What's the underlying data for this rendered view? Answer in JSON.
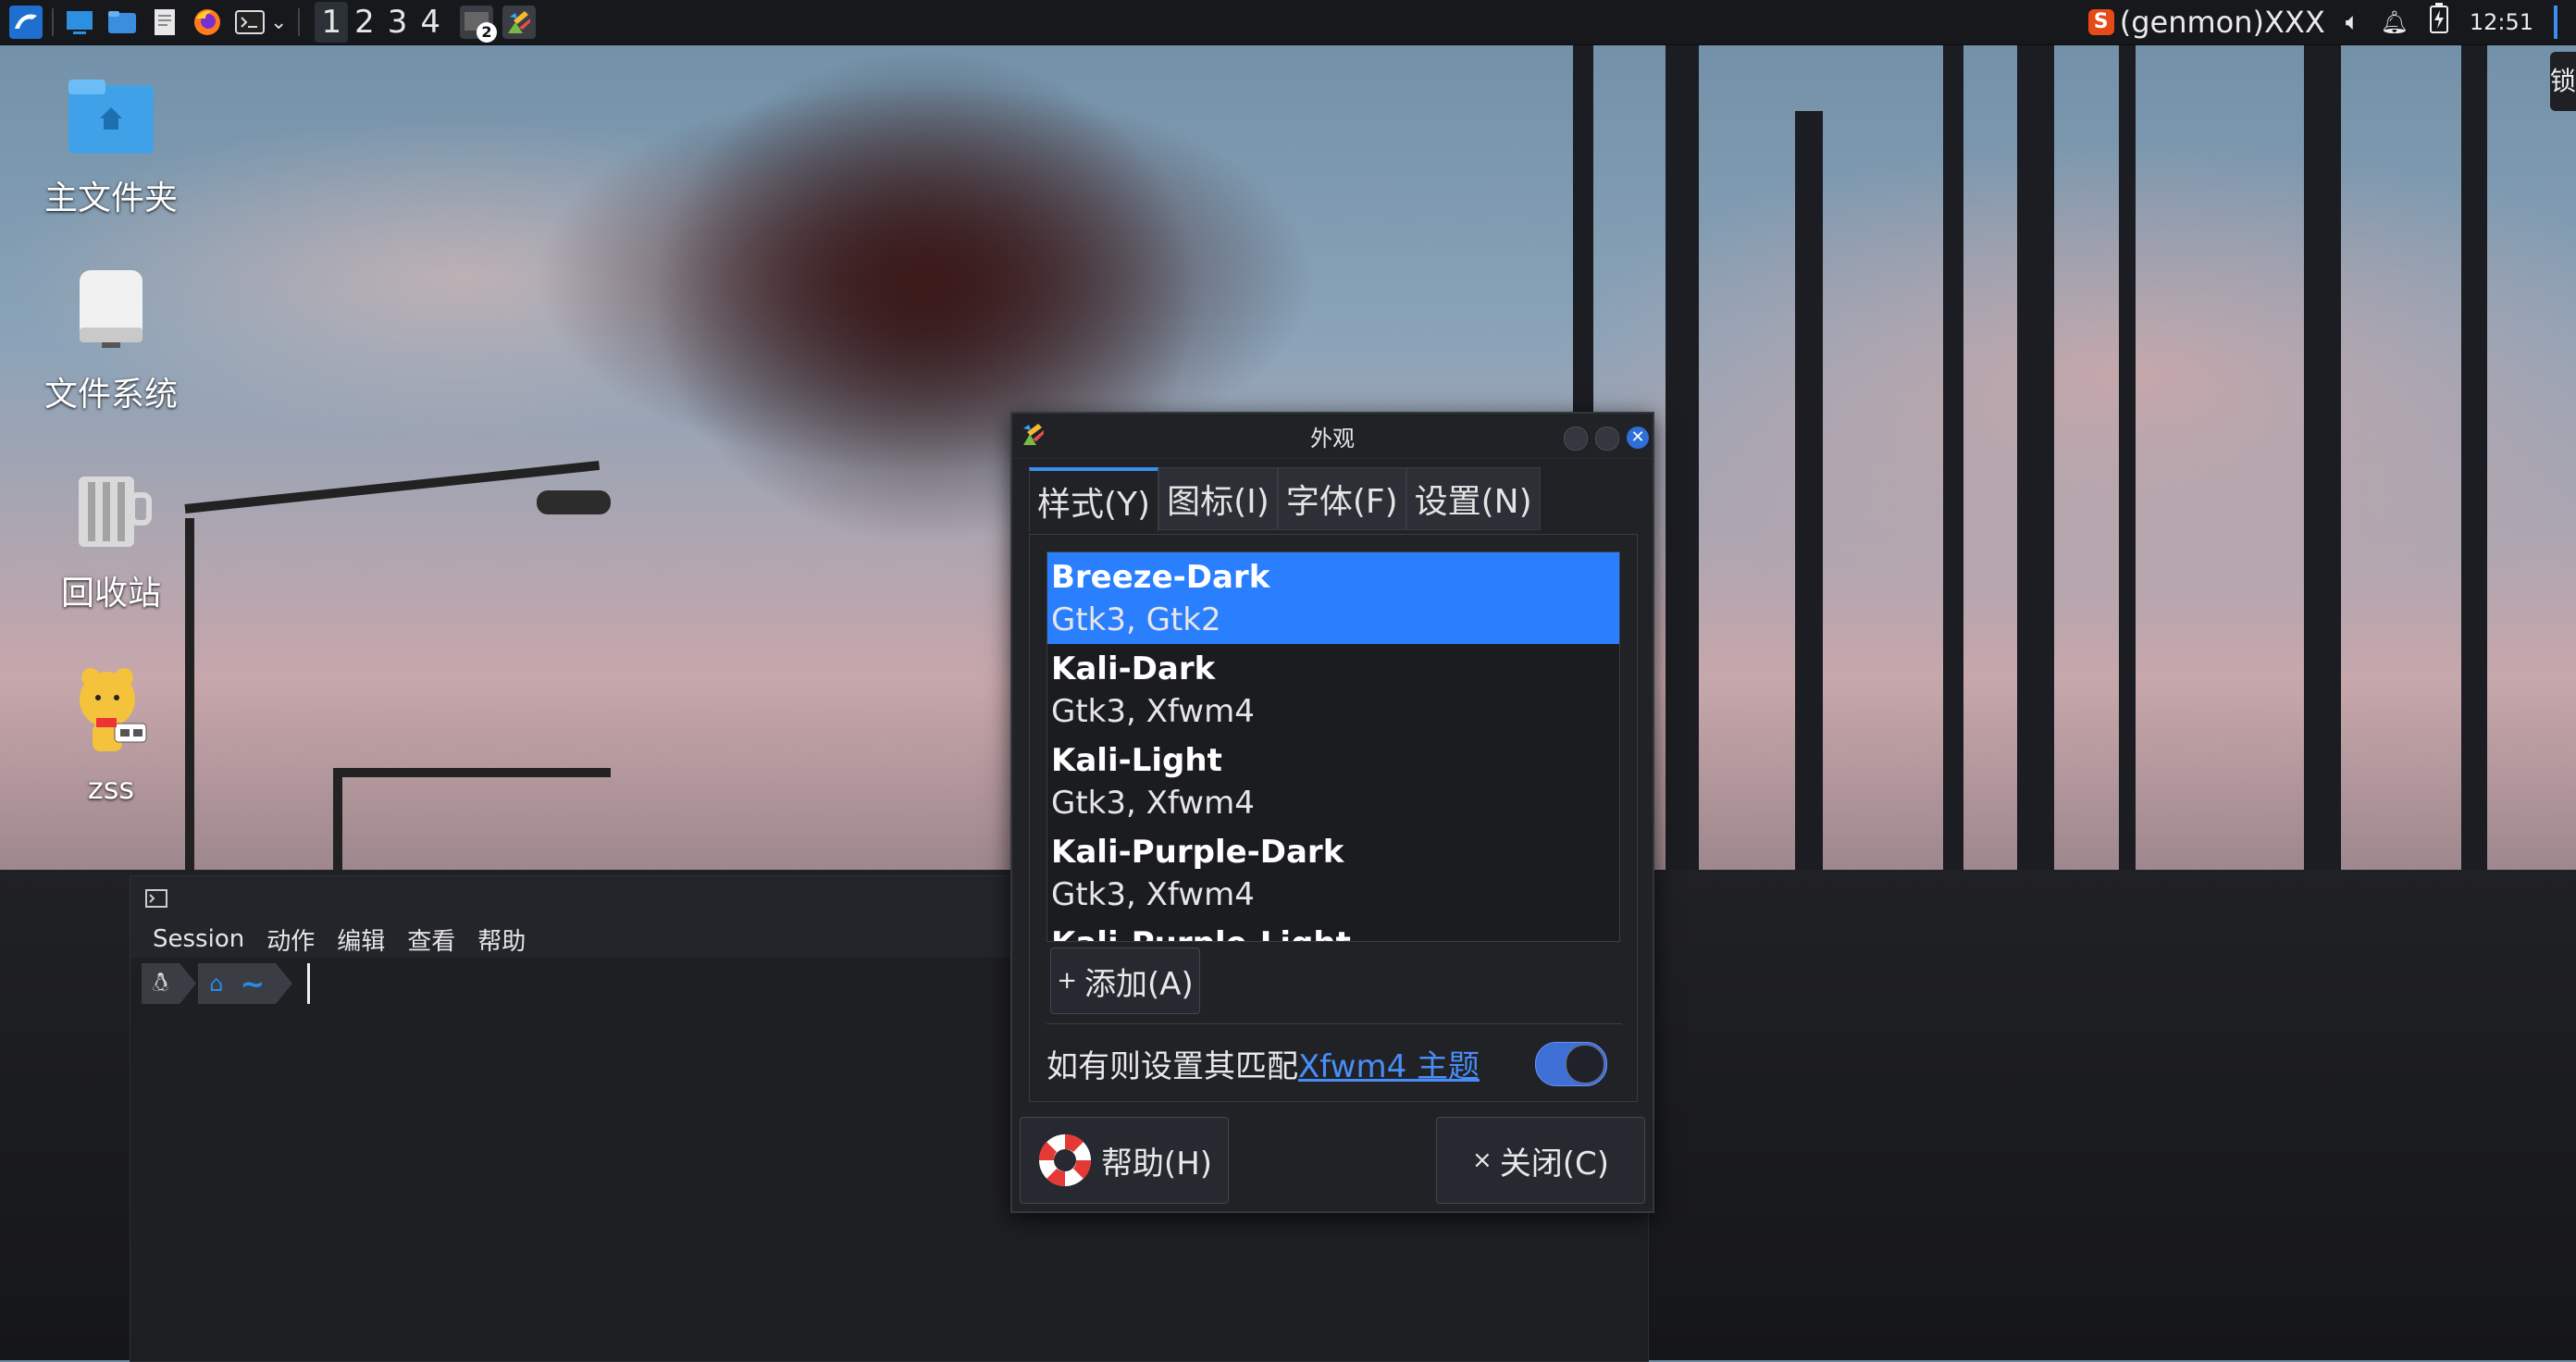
{
  "panel": {
    "workspaces": [
      "1",
      "2",
      "3",
      "4"
    ],
    "active_workspace": "1",
    "task_badge": "2",
    "genmon": "(genmon)XXX",
    "clock": "12:51",
    "edge_char": "锁"
  },
  "desktop": {
    "icons": [
      {
        "label": "主文件夹",
        "icon": "home-folder-icon"
      },
      {
        "label": "文件系统",
        "icon": "filesystem-drive-icon"
      },
      {
        "label": "回收站",
        "icon": "trash-icon"
      },
      {
        "label": "zss",
        "icon": "user-mascot-icon"
      }
    ]
  },
  "terminal": {
    "menu": [
      "Session",
      "动作",
      "编辑",
      "查看",
      "帮助"
    ],
    "prompt_tilde": "~"
  },
  "dialog": {
    "title": "外观",
    "tabs": [
      "样式(Y)",
      "图标(I)",
      "字体(F)",
      "设置(N)"
    ],
    "themes": [
      {
        "name": "Breeze-Dark",
        "sub": "Gtk3, Gtk2",
        "selected": true
      },
      {
        "name": "Kali-Dark",
        "sub": "Gtk3, Xfwm4",
        "selected": false
      },
      {
        "name": "Kali-Light",
        "sub": "Gtk3, Xfwm4",
        "selected": false
      },
      {
        "name": "Kali-Purple-Dark",
        "sub": "Gtk3, Xfwm4",
        "selected": false
      },
      {
        "name": "Kali-Purple-Light",
        "sub": "",
        "selected": false
      }
    ],
    "add_label": "添加(A)",
    "add_prefix": "+",
    "match_text": "如有则设置其匹配",
    "match_link": "Xfwm4 主题",
    "match_enabled": true,
    "help_label": "帮助(H)",
    "close_label": "关闭(C)",
    "close_prefix": "×"
  },
  "colors": {
    "accent": "#2a7fff",
    "link": "#4b8df8",
    "close_button": "#2f6fd8"
  }
}
